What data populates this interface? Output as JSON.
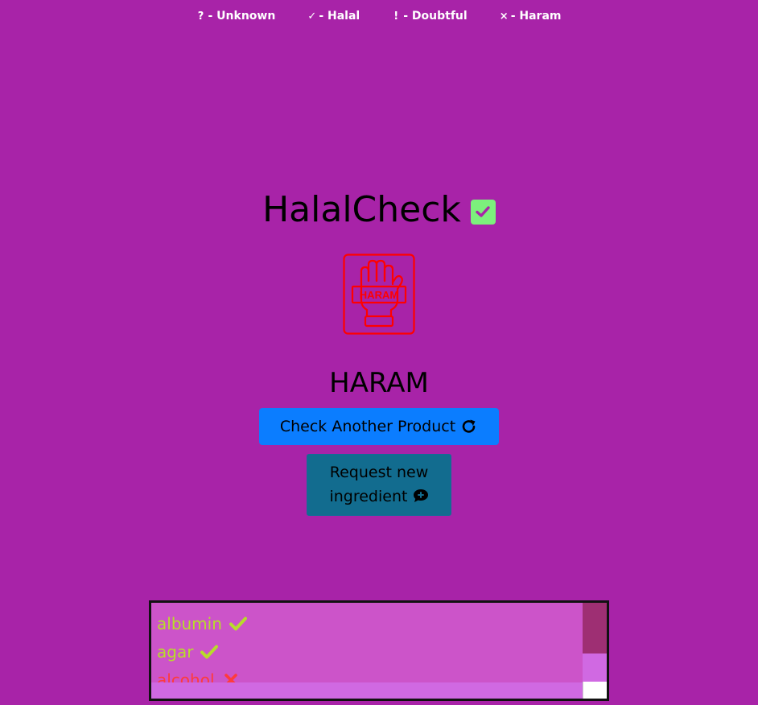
{
  "legend": [
    {
      "symbol": "?",
      "label": "- Unknown"
    },
    {
      "symbol": "✓",
      "label": "- Halal"
    },
    {
      "symbol": "!",
      "label": "- Doubtful"
    },
    {
      "symbol": "×",
      "label": "- Haram"
    }
  ],
  "app": {
    "title": "HalalCheck",
    "title_badge_icon": "check-square-icon",
    "status_icon": "haram-hand-icon",
    "status_icon_text": "HARAM",
    "verdict": "HARAM"
  },
  "actions": {
    "check_another_label": "Check Another Product",
    "check_another_icon": "refresh-icon",
    "request_ingredient_label": "Request new ingredient",
    "request_ingredient_icon": "comment-plus-icon"
  },
  "ingredients": [
    {
      "name": "albumin",
      "status": "halal",
      "icon": "check-icon"
    },
    {
      "name": "agar",
      "status": "halal",
      "icon": "check-icon"
    },
    {
      "name": "alcohol",
      "status": "haram",
      "icon": "cross-icon"
    }
  ],
  "colors": {
    "background": "#a823a8",
    "halal": "#b8dc2a",
    "haram": "#ff3b3b",
    "primary_button": "#0b7dff",
    "secondary_button": "#126c8f",
    "title_badge": "#7cf07c"
  }
}
